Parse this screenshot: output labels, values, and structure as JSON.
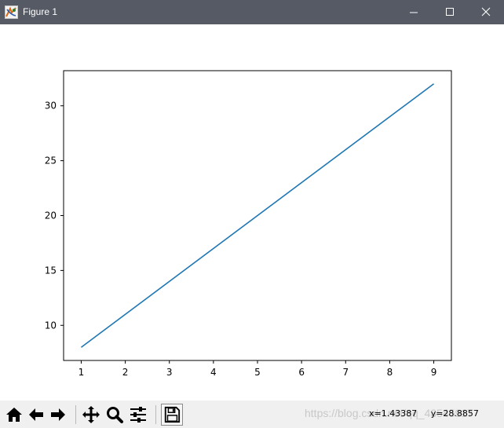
{
  "window": {
    "title": "Figure 1",
    "icon": "matplotlib-figure-icon",
    "controls": [
      "minimize-icon",
      "maximize-icon",
      "close-icon"
    ],
    "titlebar_color": "#555a64"
  },
  "toolbar": {
    "buttons": [
      "home-icon",
      "back-arrow-icon",
      "forward-arrow-icon",
      "pan-icon",
      "zoom-icon",
      "configure-subplots-icon",
      "save-icon"
    ],
    "coords": {
      "x": "x=1.43387",
      "y": "y=28.8857"
    },
    "watermark": "https://blog.csdn.net/qq_43545917"
  },
  "chart_data": {
    "type": "line",
    "title": "",
    "xlabel": "",
    "ylabel": "",
    "x": [
      1,
      9
    ],
    "series": [
      {
        "values": [
          8,
          32
        ],
        "color": "#1f77b4"
      }
    ],
    "xlim": [
      0.6,
      9.4
    ],
    "ylim": [
      6.8,
      33.2
    ],
    "xticks": [
      1,
      2,
      3,
      4,
      5,
      6,
      7,
      8,
      9
    ],
    "yticks": [
      10,
      15,
      20,
      25,
      30
    ],
    "grid": false
  }
}
